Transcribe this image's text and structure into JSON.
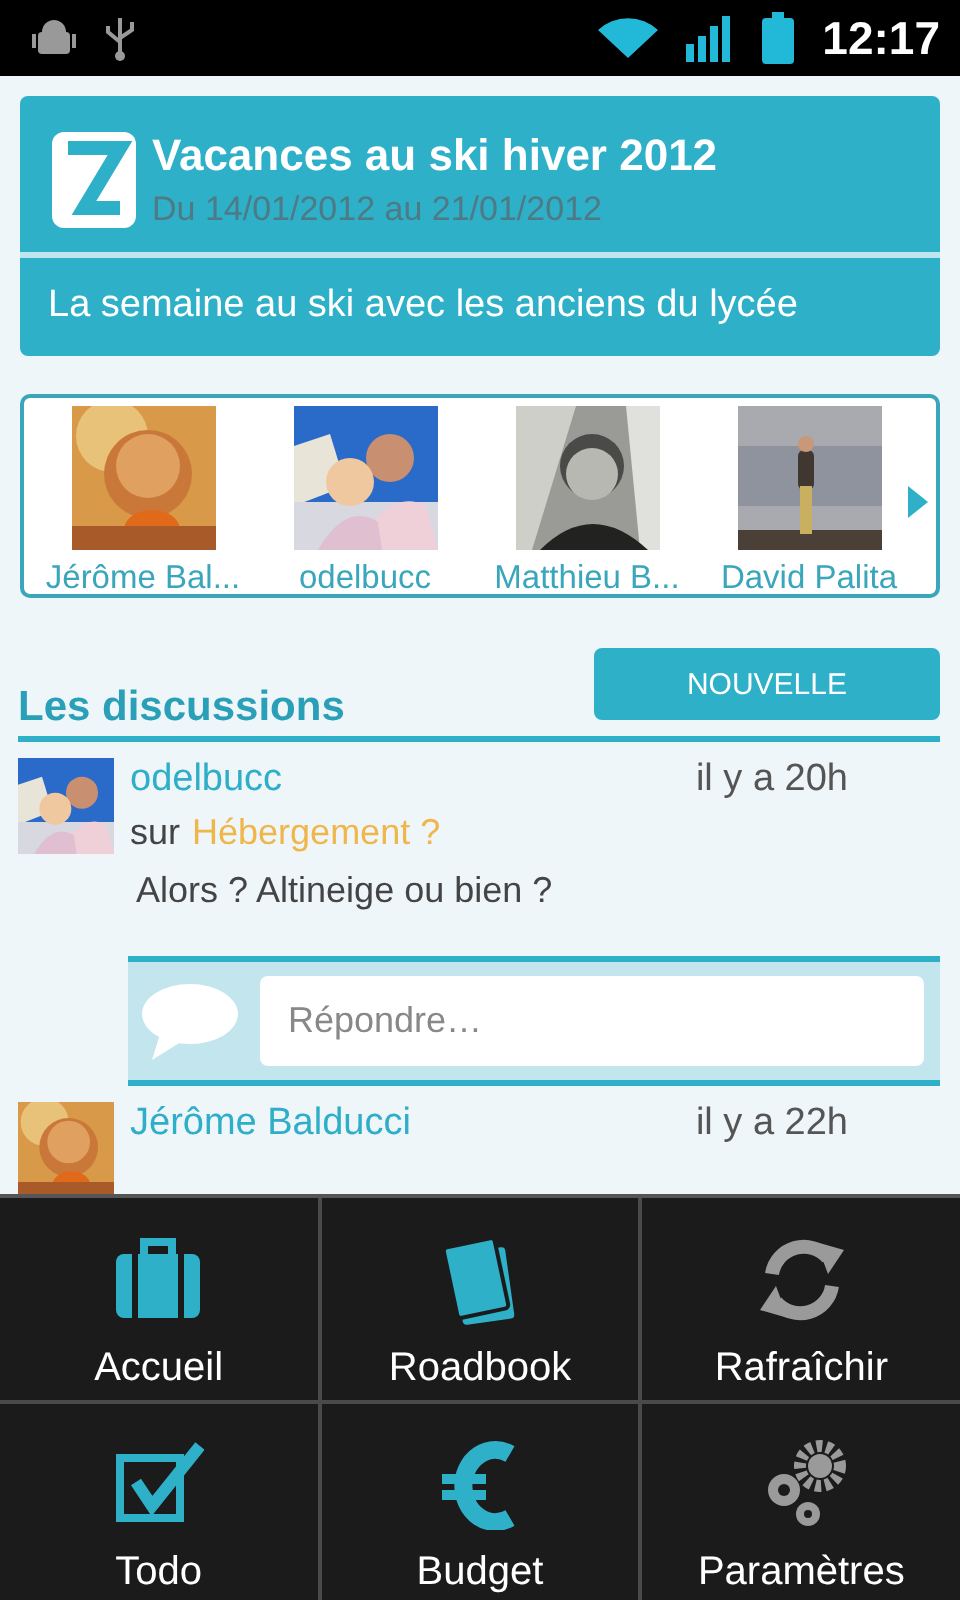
{
  "status_bar": {
    "time": "12:17"
  },
  "event": {
    "title": "Vacances au ski hiver 2012",
    "dates": "Du 14/01/2012 au 21/01/2012",
    "description": "La semaine au ski avec les anciens du lycée"
  },
  "members": [
    {
      "name": "Jérôme Bal..."
    },
    {
      "name": "odelbucc"
    },
    {
      "name": "Matthieu B..."
    },
    {
      "name": "David Palita"
    }
  ],
  "discussions": {
    "title": "Les discussions",
    "new_button": "NOUVELLE",
    "items": [
      {
        "author": "odelbucc",
        "time": "il y a 20h",
        "on": "sur",
        "topic": "Hébergement ?",
        "message": "Alors ? Altineige ou bien ?",
        "reply_placeholder": "Répondre…"
      },
      {
        "author": "Jérôme Balducci",
        "time": "il y a 22h"
      }
    ]
  },
  "menu": [
    {
      "label": "Accueil"
    },
    {
      "label": "Roadbook"
    },
    {
      "label": "Rafraîchir"
    },
    {
      "label": "Todo"
    },
    {
      "label": "Budget"
    },
    {
      "label": "Paramètres"
    }
  ]
}
